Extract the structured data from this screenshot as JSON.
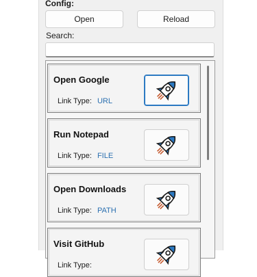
{
  "config": {
    "label": "Config:",
    "open_label": "Open",
    "reload_label": "Reload"
  },
  "search": {
    "label": "Search:",
    "value": ""
  },
  "items": [
    {
      "title": "Open Google",
      "type_label": "Link Type:",
      "type": "URL",
      "launch_icon": "rocket-icon"
    },
    {
      "title": "Run Notepad",
      "type_label": "Link Type:",
      "type": "FILE",
      "launch_icon": "rocket-icon"
    },
    {
      "title": "Open Downloads",
      "type_label": "Link Type:",
      "type": "PATH",
      "launch_icon": "rocket-icon"
    },
    {
      "title": "Visit GitHub",
      "type_label": "Link Type:",
      "type": "",
      "launch_icon": "rocket-icon"
    }
  ],
  "colors": {
    "accent": "#2b79c2",
    "link_type": "#2a6fb0"
  }
}
